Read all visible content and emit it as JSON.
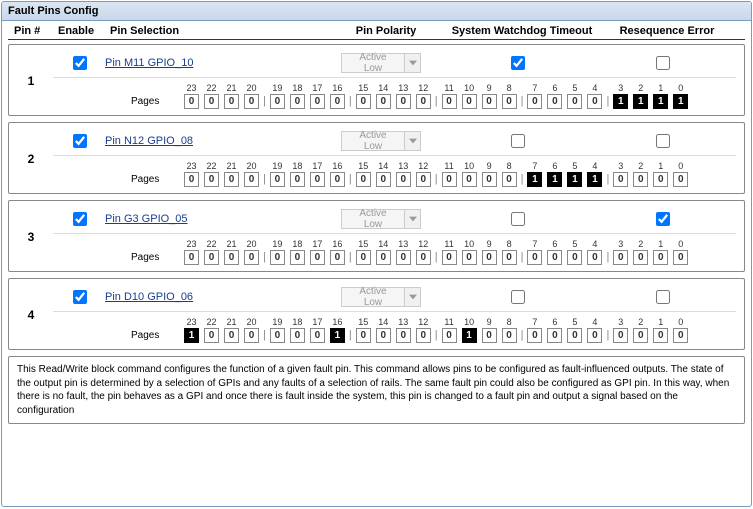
{
  "title": "Fault Pins Config",
  "headers": {
    "pin": "Pin #",
    "enable": "Enable",
    "pinsel": "Pin Selection",
    "polarity": "Pin Polarity",
    "swt": "System Watchdog Timeout",
    "reseq": "Resequence Error"
  },
  "polarity_value": "Active Low",
  "pages_label": "Pages",
  "bit_indices": [
    23,
    22,
    21,
    20,
    19,
    18,
    17,
    16,
    15,
    14,
    13,
    12,
    11,
    10,
    9,
    8,
    7,
    6,
    5,
    4,
    3,
    2,
    1,
    0
  ],
  "rows": [
    {
      "num": "1",
      "pin_link": "Pin M11 GPIO_10",
      "enable": true,
      "swt": true,
      "reseq": false,
      "bits": [
        0,
        0,
        0,
        0,
        0,
        0,
        0,
        0,
        0,
        0,
        0,
        0,
        0,
        0,
        0,
        0,
        0,
        0,
        0,
        0,
        1,
        1,
        1,
        1
      ]
    },
    {
      "num": "2",
      "pin_link": "Pin N12 GPIO_08",
      "enable": true,
      "swt": false,
      "reseq": false,
      "bits": [
        0,
        0,
        0,
        0,
        0,
        0,
        0,
        0,
        0,
        0,
        0,
        0,
        0,
        0,
        0,
        0,
        1,
        1,
        1,
        1,
        0,
        0,
        0,
        0
      ]
    },
    {
      "num": "3",
      "pin_link": "Pin G3 GPIO_05",
      "enable": true,
      "swt": false,
      "reseq": true,
      "bits": [
        0,
        0,
        0,
        0,
        0,
        0,
        0,
        0,
        0,
        0,
        0,
        0,
        0,
        0,
        0,
        0,
        0,
        0,
        0,
        0,
        0,
        0,
        0,
        0
      ]
    },
    {
      "num": "4",
      "pin_link": "Pin D10 GPIO_06",
      "enable": true,
      "swt": false,
      "reseq": false,
      "bits": [
        1,
        0,
        0,
        0,
        0,
        0,
        0,
        1,
        0,
        0,
        0,
        0,
        0,
        1,
        0,
        0,
        0,
        0,
        0,
        0,
        0,
        0,
        0,
        0
      ]
    }
  ],
  "description": "This Read/Write block command configures the function of a given fault pin. This command allows pins to be configured as fault-influenced outputs. The state of the output pin is determined by a selection of GPIs and any faults of a selection of rails. The same fault pin could also be configured as GPI pin. In this way, when there is no fault, the pin behaves as a GPI and once there is fault inside the system, this pin is changed to a fault pin and output a signal based on the configuration"
}
